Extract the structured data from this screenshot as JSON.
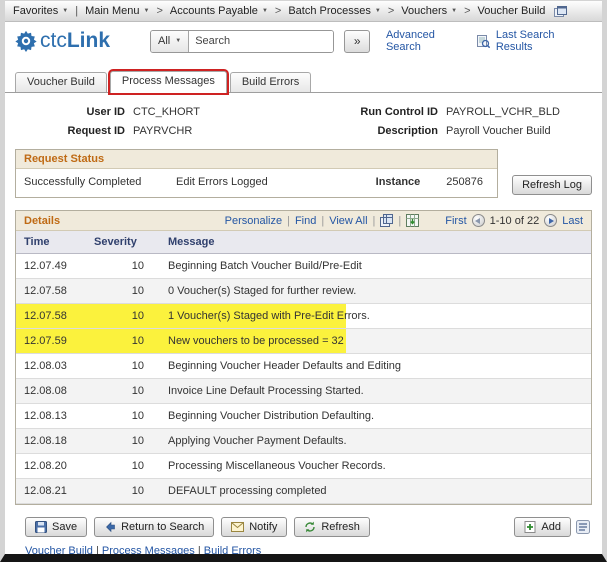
{
  "icons": {
    "caret_down": "▼",
    "pipe": "|",
    "search_go": "»"
  },
  "breadcrumb": {
    "items": [
      {
        "label": "Favorites",
        "caret": true,
        "sep": ""
      },
      {
        "label": "Main Menu",
        "caret": true,
        "sep": "|"
      },
      {
        "label": "Accounts Payable",
        "caret": true,
        "sep": ">"
      },
      {
        "label": "Batch Processes",
        "caret": true,
        "sep": ">"
      },
      {
        "label": "Vouchers",
        "caret": true,
        "sep": ">"
      },
      {
        "label": "Voucher Build",
        "caret": false,
        "sep": ">"
      }
    ]
  },
  "header": {
    "logo_prefix": "ctc",
    "logo_suffix": "Link",
    "search_scope": "All",
    "search_placeholder": "Search",
    "advanced_search": "Advanced Search",
    "last_search_results": "Last Search Results"
  },
  "tabs": [
    {
      "label": "Voucher Build",
      "active": false
    },
    {
      "label": "Process Messages",
      "active": true
    },
    {
      "label": "Build Errors",
      "active": false
    }
  ],
  "fields": {
    "user_id_label": "User ID",
    "user_id_value": "CTC_KHORT",
    "run_control_id_label": "Run Control ID",
    "run_control_id_value": "PAYROLL_VCHR_BLD",
    "request_id_label": "Request ID",
    "request_id_value": "PAYRVCHR",
    "description_label": "Description",
    "description_value": "Payroll Voucher Build"
  },
  "request_status": {
    "title": "Request Status",
    "status": "Successfully Completed",
    "edit_status": "Edit Errors Logged",
    "instance_label": "Instance",
    "instance_value": "250876",
    "refresh_log_label": "Refresh Log"
  },
  "details": {
    "title": "Details",
    "personalize": "Personalize",
    "find": "Find",
    "view_all": "View All",
    "paging": {
      "first": "First",
      "range": "1-10 of 22",
      "last": "Last"
    },
    "columns": [
      "Time",
      "Severity",
      "Message"
    ],
    "rows": [
      {
        "time": "12.07.49",
        "severity": "10",
        "message": "Beginning Batch Voucher Build/Pre-Edit",
        "highlight": false
      },
      {
        "time": "12.07.58",
        "severity": "10",
        "message": "0 Voucher(s) Staged for further review.",
        "highlight": false
      },
      {
        "time": "12.07.58",
        "severity": "10",
        "message": "1 Voucher(s) Staged with Pre-Edit Errors.",
        "highlight": true
      },
      {
        "time": "12.07.59",
        "severity": "10",
        "message": "New vouchers to be processed = 32",
        "highlight": true
      },
      {
        "time": "12.08.03",
        "severity": "10",
        "message": "Beginning Voucher Header Defaults and Editing",
        "highlight": false
      },
      {
        "time": "12.08.08",
        "severity": "10",
        "message": "Invoice Line Default Processing Started.",
        "highlight": false
      },
      {
        "time": "12.08.13",
        "severity": "10",
        "message": "Beginning Voucher Distribution Defaulting.",
        "highlight": false
      },
      {
        "time": "12.08.18",
        "severity": "10",
        "message": "Applying Voucher Payment Defaults.",
        "highlight": false
      },
      {
        "time": "12.08.20",
        "severity": "10",
        "message": "Processing Miscellaneous Voucher Records.",
        "highlight": false
      },
      {
        "time": "12.08.21",
        "severity": "10",
        "message": "DEFAULT processing completed",
        "highlight": false
      }
    ]
  },
  "footer": {
    "save_label": "Save",
    "return_to_search_label": "Return to Search",
    "notify_label": "Notify",
    "refresh_label": "Refresh",
    "add_label": "Add",
    "links": [
      "Voucher Build",
      "Process Messages",
      "Build Errors"
    ]
  }
}
